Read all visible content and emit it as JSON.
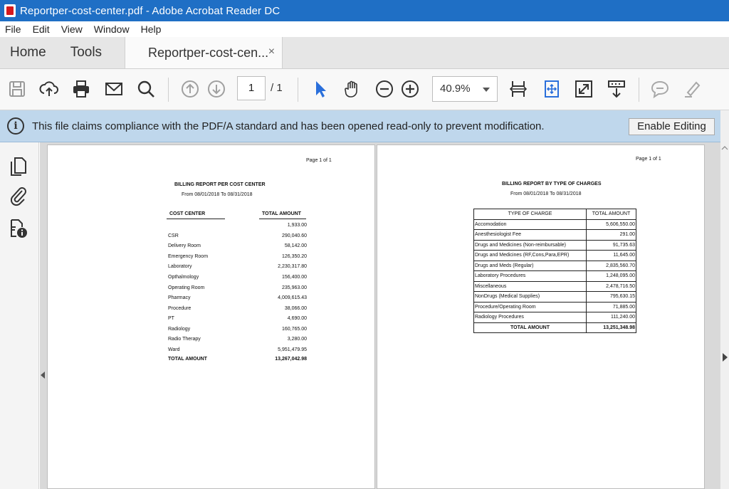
{
  "window": {
    "title": "Reportper-cost-center.pdf - Adobe Acrobat Reader DC"
  },
  "menu": {
    "items": [
      "File",
      "Edit",
      "View",
      "Window",
      "Help"
    ]
  },
  "tabs": {
    "home": "Home",
    "tools": "Tools",
    "document": "Reportper-cost-cen...",
    "close": "×"
  },
  "toolbar": {
    "page_current": "1",
    "page_total": "/ 1",
    "zoom": "40.9%",
    "accent_color": "#2a6fdb"
  },
  "banner": {
    "message": "This file claims compliance with the PDF/A standard and has been opened read-only to prevent modification.",
    "button": "Enable Editing"
  },
  "page1": {
    "page_label": "Page 1 of 1",
    "title": "BILLING REPORT PER COST CENTER",
    "subtitle": "From  08/01/2018  To  08/31/2018",
    "col_center": "COST CENTER",
    "col_amount": "TOTAL AMOUNT",
    "rows": [
      {
        "label": "",
        "value": "1,933.00"
      },
      {
        "label": "CSR",
        "value": "290,040.60"
      },
      {
        "label": "Delivery Room",
        "value": "58,142.00"
      },
      {
        "label": "Emergency Room",
        "value": "126,350.20"
      },
      {
        "label": "Laboratory",
        "value": "2,230,317.80"
      },
      {
        "label": "Opthalmology",
        "value": "156,400.00"
      },
      {
        "label": "Operating Room",
        "value": "235,963.00"
      },
      {
        "label": "Pharmacy",
        "value": "4,009,615.43"
      },
      {
        "label": "Procedure",
        "value": "38,066.00"
      },
      {
        "label": "PT",
        "value": "4,690.00"
      },
      {
        "label": "Radiology",
        "value": "160,765.00"
      },
      {
        "label": "Radio Therapy",
        "value": "3,280.00"
      },
      {
        "label": "Ward",
        "value": "5,951,479.95"
      }
    ],
    "total_label": "TOTAL AMOUNT",
    "total_value": "13,267,042.98"
  },
  "page2": {
    "page_label": "Page 1 of 1",
    "title": "BILLING REPORT BY TYPE OF CHARGES",
    "subtitle": "From  08/01/2018  To  08/31/2018",
    "col_type": "TYPE OF CHARGE",
    "col_amount": "TOTAL AMOUNT",
    "rows": [
      {
        "label": "Accomodation",
        "value": "5,606,550.00"
      },
      {
        "label": "Anesthesiologist Fee",
        "value": "291.00"
      },
      {
        "label": "Drugs and Medicines (Non-reimbursable)",
        "value": "91,735.63"
      },
      {
        "label": "Drugs and Medicines (RF,Cons,Para,EPR)",
        "value": "11,645.00"
      },
      {
        "label": "Drugs and Meds (Regular)",
        "value": "2,835,560.70"
      },
      {
        "label": "Laboratory Procedures",
        "value": "1,248,095.00"
      },
      {
        "label": "Miscellaneous",
        "value": "2,478,716.50"
      },
      {
        "label": "NonDrugs (Medical Supplies)",
        "value": "795,630.15"
      },
      {
        "label": "Procedure/Operating Room",
        "value": "71,885.00"
      },
      {
        "label": "Radiology Procedures",
        "value": "111,240.00"
      }
    ],
    "total_label": "TOTAL AMOUNT",
    "total_value": "13,251,348.98"
  }
}
